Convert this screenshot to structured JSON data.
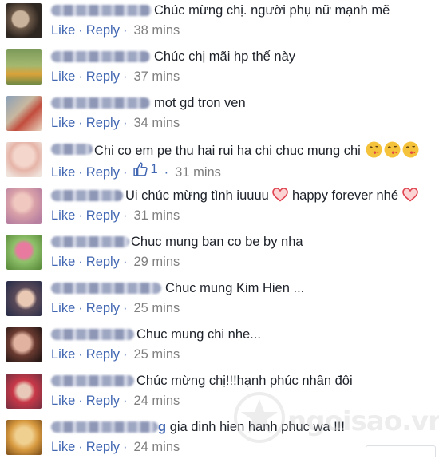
{
  "colors": {
    "link": "#4267b2",
    "text": "#1d2129",
    "time": "#7f7f7f"
  },
  "comments": [
    {
      "text": "Chúc mừng chị. người phụ nữ mạnh mẽ",
      "like": "Like",
      "reply": "Reply",
      "time": "38 mins"
    },
    {
      "text": "Chúc chị mãi hp thế này",
      "like": "Like",
      "reply": "Reply",
      "time": "37 mins"
    },
    {
      "text": "mot gd tron ven",
      "like": "Like",
      "reply": "Reply",
      "time": "34 mins"
    },
    {
      "text": "Chi co em pe thu hai rui ha chi chuc mung chi",
      "like": "Like",
      "reply": "Reply",
      "likes_count": "1",
      "time": "31 mins",
      "emojis": [
        "kiss-emoji",
        "kiss-emoji",
        "kiss-emoji"
      ]
    },
    {
      "text_a": "Ui chúc mừng tình iuuuu",
      "text_b": "happy forever nhé",
      "like": "Like",
      "reply": "Reply",
      "time": "31 mins",
      "emojis": [
        "heart-emoji",
        "heart-emoji"
      ]
    },
    {
      "text": "Chuc mung ban co be by nha",
      "like": "Like",
      "reply": "Reply",
      "time": "29 mins"
    },
    {
      "text": "Chuc mung Kim Hien ...",
      "like": "Like",
      "reply": "Reply",
      "time": "25 mins"
    },
    {
      "text": "Chuc mung chi nhe...",
      "like": "Like",
      "reply": "Reply",
      "time": "25 mins"
    },
    {
      "text": "Chúc mừng chị!!!hạnh phúc nhân đôi",
      "like": "Like",
      "reply": "Reply",
      "time": "24 mins"
    },
    {
      "author_end": "g",
      "text": "gia dinh hien hanh phuc wa !!!",
      "like": "Like",
      "reply": "Reply",
      "time": "24 mins"
    }
  ],
  "watermark": "ngoisao.vn"
}
